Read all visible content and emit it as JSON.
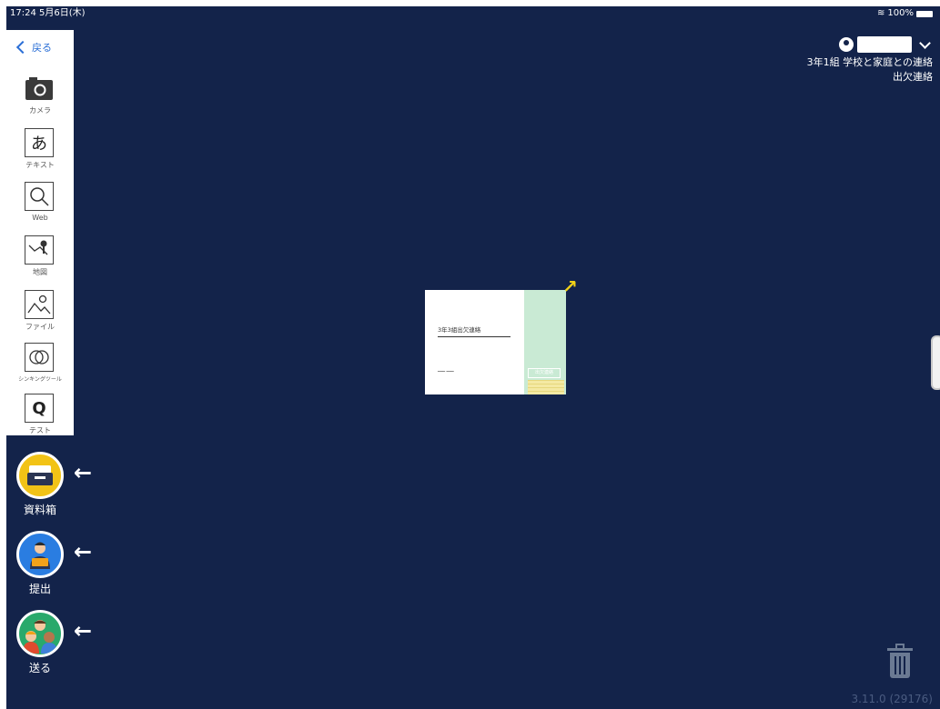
{
  "status": {
    "time_date": "17:24  5月6日(木)",
    "battery": "100%"
  },
  "toolbar": {
    "back_label": "戻る",
    "tools": [
      {
        "label": "カメラ",
        "icon": "camera-icon"
      },
      {
        "label": "テキスト",
        "icon": "text-a-icon",
        "glyph": "あ"
      },
      {
        "label": "Web",
        "icon": "magnifier-icon"
      },
      {
        "label": "地図",
        "icon": "map-pin-icon"
      },
      {
        "label": "ファイル",
        "icon": "image-file-icon"
      },
      {
        "label": "シンキングツール",
        "icon": "thinking-tool-icon"
      },
      {
        "label": "テスト",
        "icon": "test-q-icon",
        "glyph": "Q"
      }
    ]
  },
  "actions": {
    "materials_label": "資料箱",
    "submit_label": "提出",
    "send_label": "送る"
  },
  "user": {
    "class_name": "3年1組 学校と家庭との連絡",
    "subtitle": "出欠連絡"
  },
  "card": {
    "title": "3年3組出欠連絡",
    "stamp": "出欠連絡"
  },
  "footer": {
    "version": "3.11.0 (29176)"
  },
  "colors": {
    "background": "#13234a",
    "materials_circle": "#f2c316",
    "submit_circle": "#2a7de1",
    "send_circle": "#29a96b",
    "card_accent": "#c9ead4",
    "expand_arrow": "#f2d218"
  }
}
